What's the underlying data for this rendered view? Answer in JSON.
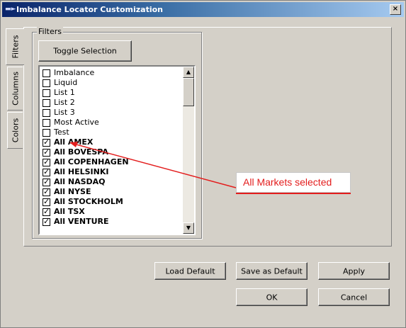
{
  "window": {
    "title": "Imbalance Locator Customization",
    "close_glyph": "×"
  },
  "tabs": [
    {
      "label": "Filters",
      "active": true
    },
    {
      "label": "Columns",
      "active": false
    },
    {
      "label": "Colors",
      "active": false
    }
  ],
  "filters_group": {
    "label": "Filters",
    "toggle_button": "Toggle Selection",
    "items": [
      {
        "label": "Imbalance",
        "checked": false,
        "bold": false
      },
      {
        "label": "Liquid",
        "checked": false,
        "bold": false
      },
      {
        "label": "List 1",
        "checked": false,
        "bold": false
      },
      {
        "label": "List 2",
        "checked": false,
        "bold": false
      },
      {
        "label": "List 3",
        "checked": false,
        "bold": false
      },
      {
        "label": "Most Active",
        "checked": false,
        "bold": false
      },
      {
        "label": "Test",
        "checked": false,
        "bold": false
      },
      {
        "label": "All AMEX",
        "checked": true,
        "bold": true
      },
      {
        "label": "All BOVESPA",
        "checked": true,
        "bold": true
      },
      {
        "label": "All COPENHAGEN",
        "checked": true,
        "bold": true
      },
      {
        "label": "All HELSINKI",
        "checked": true,
        "bold": true
      },
      {
        "label": "All NASDAQ",
        "checked": true,
        "bold": true
      },
      {
        "label": "All NYSE",
        "checked": true,
        "bold": true
      },
      {
        "label": "All STOCKHOLM",
        "checked": true,
        "bold": true
      },
      {
        "label": "All TSX",
        "checked": true,
        "bold": true
      },
      {
        "label": "All VENTURE",
        "checked": true,
        "bold": true
      }
    ],
    "scroll_up_glyph": "▲",
    "scroll_down_glyph": "▼",
    "check_glyph": "✓"
  },
  "annotation": {
    "text": "All Markets selected",
    "color": "#e31d1d"
  },
  "buttons": {
    "load_default": "Load Default",
    "save_as_default": "Save as Default",
    "apply": "Apply",
    "ok": "OK",
    "cancel": "Cancel"
  },
  "colors": {
    "dialog_bg": "#d4d0c8",
    "titlebar_start": "#0a246a",
    "titlebar_end": "#a6caf0"
  }
}
